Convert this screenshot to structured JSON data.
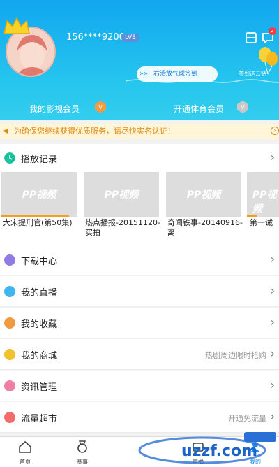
{
  "header": {
    "username": "156****9200",
    "level": "LV3",
    "message_badge": "2",
    "swipe_hint": "右滑放气球签到",
    "checkin_reward": "签到送云钻",
    "membership_left": "我的影视会员",
    "membership_right": "开通体育会员"
  },
  "notice": {
    "text": "为确保您继续获得优质服务，请尽快实名认证！"
  },
  "history": {
    "label": "播放记录",
    "items": [
      {
        "title": "大宋提刑官(第50集)",
        "progress": 0.9
      },
      {
        "title": "热点播报-20151120-实拍",
        "progress": 0
      },
      {
        "title": "奇闻铁事-20140916-离",
        "progress": 0
      },
      {
        "title": "第一诫",
        "progress": 0.3
      }
    ],
    "placeholder": "PP视频"
  },
  "menu": [
    {
      "label": "下载中心",
      "right": "",
      "color": "#8f7be3"
    },
    {
      "label": "我的直播",
      "right": "",
      "color": "#3db6f2"
    },
    {
      "label": "我的收藏",
      "right": "",
      "color": "#f29a3e"
    },
    {
      "label": "我的商城",
      "right": "热剧周边限时抢购",
      "color": "#f0c22c"
    },
    {
      "label": "资讯管理",
      "right": "",
      "color": "#f07fa5"
    },
    {
      "label": "流量超市",
      "right": "开通免流量",
      "color": "#f46b6b"
    }
  ],
  "tabs": [
    {
      "label": "首页"
    },
    {
      "label": "赛事"
    },
    {
      "label": ""
    },
    {
      "label": "直播"
    },
    {
      "label": "我的"
    }
  ],
  "watermark": "uzzf.com",
  "colors": {
    "accent": "#1a8be6",
    "header": "#12a7ef",
    "notice": "#e08a14"
  }
}
